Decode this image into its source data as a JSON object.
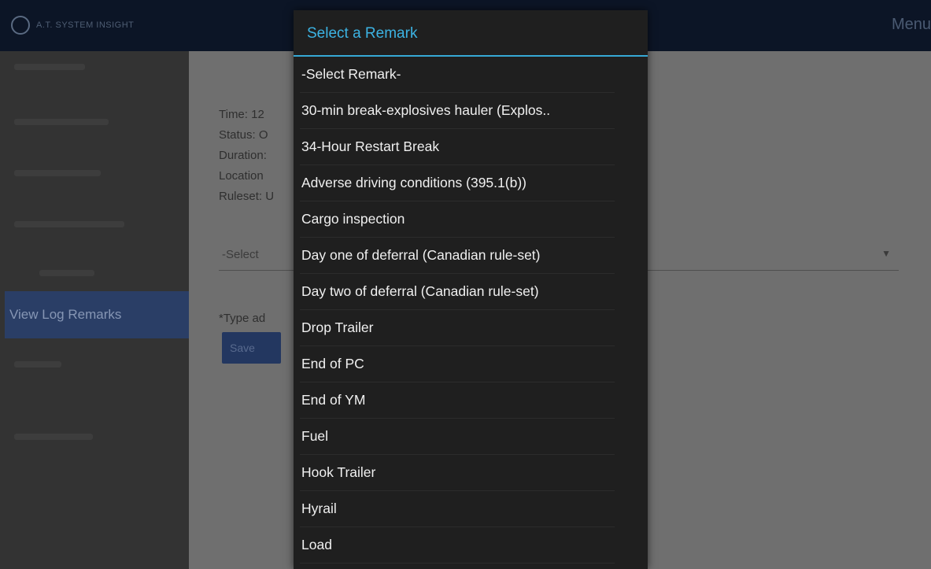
{
  "app": {
    "logo_text": "A.T. SYSTEM INSIGHT",
    "menu_label": "Menu"
  },
  "sidebar": {
    "active_label": "View Log Remarks"
  },
  "content": {
    "info": {
      "time": "Time: 12",
      "status": "Status: O",
      "duration": "Duration:",
      "location": "Location",
      "ruleset": "Ruleset: U"
    },
    "select_placeholder": "-Select",
    "type_label": "*Type ad",
    "save_label": "Save"
  },
  "dialog": {
    "title": "Select a Remark",
    "options": [
      "-Select Remark-",
      "30-min break-explosives hauler (Explos..",
      "34-Hour Restart Break",
      "Adverse driving conditions (395.1(b))",
      "Cargo inspection",
      "Day one of deferral (Canadian rule-set)",
      "Day two of deferral  (Canadian rule-set)",
      "Drop Trailer",
      "End of PC",
      "End of YM",
      "Fuel",
      "Hook Trailer",
      "Hyrail",
      "Load"
    ]
  },
  "colors": {
    "accent": "#3cb3e3",
    "dialog_bg": "#1f1f1f",
    "topbar_bg": "#0c1526",
    "sidebar_active": "#2a3e66"
  }
}
